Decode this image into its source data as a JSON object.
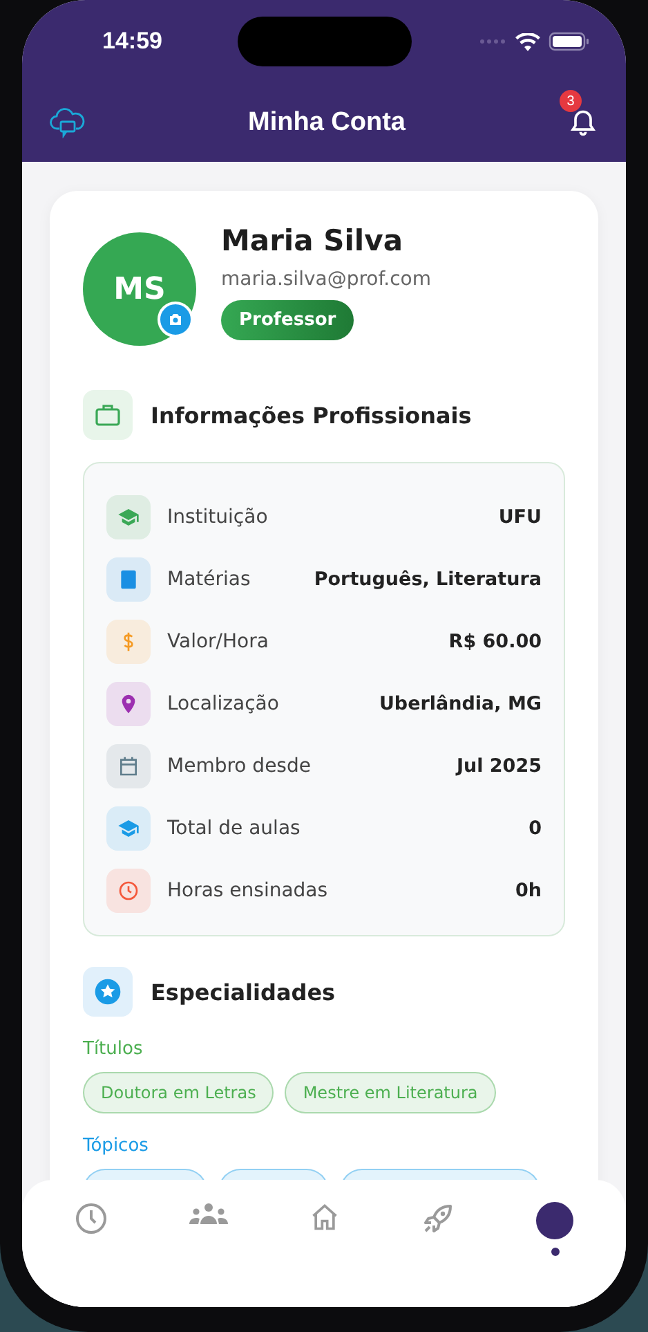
{
  "status_bar": {
    "time": "14:59"
  },
  "header": {
    "title": "Minha Conta",
    "notification_count": "3"
  },
  "profile": {
    "initials": "MS",
    "name": "Maria Silva",
    "email": "maria.silva@prof.com",
    "role": "Professor"
  },
  "professional_info": {
    "title": "Informações Profissionais",
    "rows": [
      {
        "kind": "graduation",
        "label": "Instituição",
        "value": "UFU",
        "color": "#3aa856"
      },
      {
        "kind": "book",
        "label": "Matérias",
        "value": "Português, Literatura",
        "color": "#1a8fe3"
      },
      {
        "kind": "dollar",
        "label": "Valor/Hora",
        "value": "R$ 60.00",
        "color": "#f59a23"
      },
      {
        "kind": "pin",
        "label": "Localização",
        "value": "Uberlândia, MG",
        "color": "#9c2fb0"
      },
      {
        "kind": "calendar",
        "label": "Membro desde",
        "value": "Jul 2025",
        "color": "#5f7d8c"
      },
      {
        "kind": "graduation",
        "label": "Total de aulas",
        "value": "0",
        "color": "#1a9be6"
      },
      {
        "kind": "clock",
        "label": "Horas ensinadas",
        "value": "0h",
        "color": "#f4583b"
      }
    ]
  },
  "specialties": {
    "title": "Especialidades",
    "groups": [
      {
        "title": "Títulos",
        "color": "#4caf50",
        "tags": [
          "Doutora em Letras",
          "Mestre em Literatura"
        ]
      },
      {
        "title": "Tópicos",
        "color": "#1a9be6",
        "covered_tags": true
      }
    ]
  },
  "tabs": [
    {
      "kind": "clock",
      "selected": false
    },
    {
      "kind": "people",
      "selected": false
    },
    {
      "kind": "home",
      "selected": false
    },
    {
      "kind": "rocket",
      "selected": false
    },
    {
      "kind": "profile",
      "selected": true
    }
  ]
}
